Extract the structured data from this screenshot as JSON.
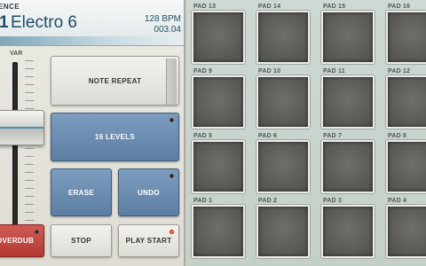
{
  "display": {
    "header": "ENCE",
    "sequence_number": "1",
    "sequence_name": "Electro 6",
    "bpm": "128 BPM",
    "position": "003.04"
  },
  "fader": {
    "label": "VAR"
  },
  "buttons": {
    "note_repeat": "NOTE REPEAT",
    "sixteen_levels": "16 LEVELS",
    "erase": "ERASE",
    "undo": "UNDO",
    "overdub": "OVERDUB",
    "stop": "STOP",
    "play_start": "PLAY START"
  },
  "colors": {
    "accent_blue": "#5c7ea3",
    "overdub_red": "#b33a35",
    "pad_grey": "#5b5c58",
    "display_text": "#1c4f64"
  },
  "pads": [
    [
      "PAD 13",
      "PAD 14",
      "PAD 15",
      "PAD 16"
    ],
    [
      "PAD 9",
      "PAD 10",
      "PAD 11",
      "PAD 12"
    ],
    [
      "PAD 5",
      "PAD 6",
      "PAD 7",
      "PAD 8"
    ],
    [
      "PAD 1",
      "PAD 2",
      "PAD 3",
      "PAD 4"
    ]
  ]
}
